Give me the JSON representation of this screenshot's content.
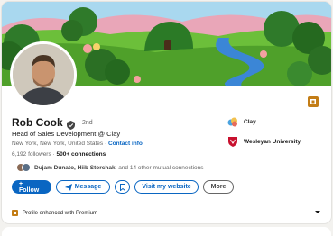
{
  "profile": {
    "name": "Rob Cook",
    "degree": "· 2nd",
    "headline": "Head of Sales Development @ Clay",
    "location": "New York, New York, United States ·",
    "contact_info": "Contact info",
    "followers": "6,192 followers",
    "connections": "500+ connections",
    "connections_sep": " · ",
    "mutual_names": "Dujam Dunato, Hiib Storchak",
    "mutual_rest": ", and 14 other mutual connections"
  },
  "actions": {
    "follow": "+ Follow",
    "message": "Message",
    "website": "Visit my website",
    "more": "More"
  },
  "side": {
    "company": "Clay",
    "school": "Wesleyan University"
  },
  "premium": {
    "label": "Profile enhanced with Premium"
  },
  "colors": {
    "accent": "#0a66c2",
    "premium_gold": "#c37d16"
  }
}
